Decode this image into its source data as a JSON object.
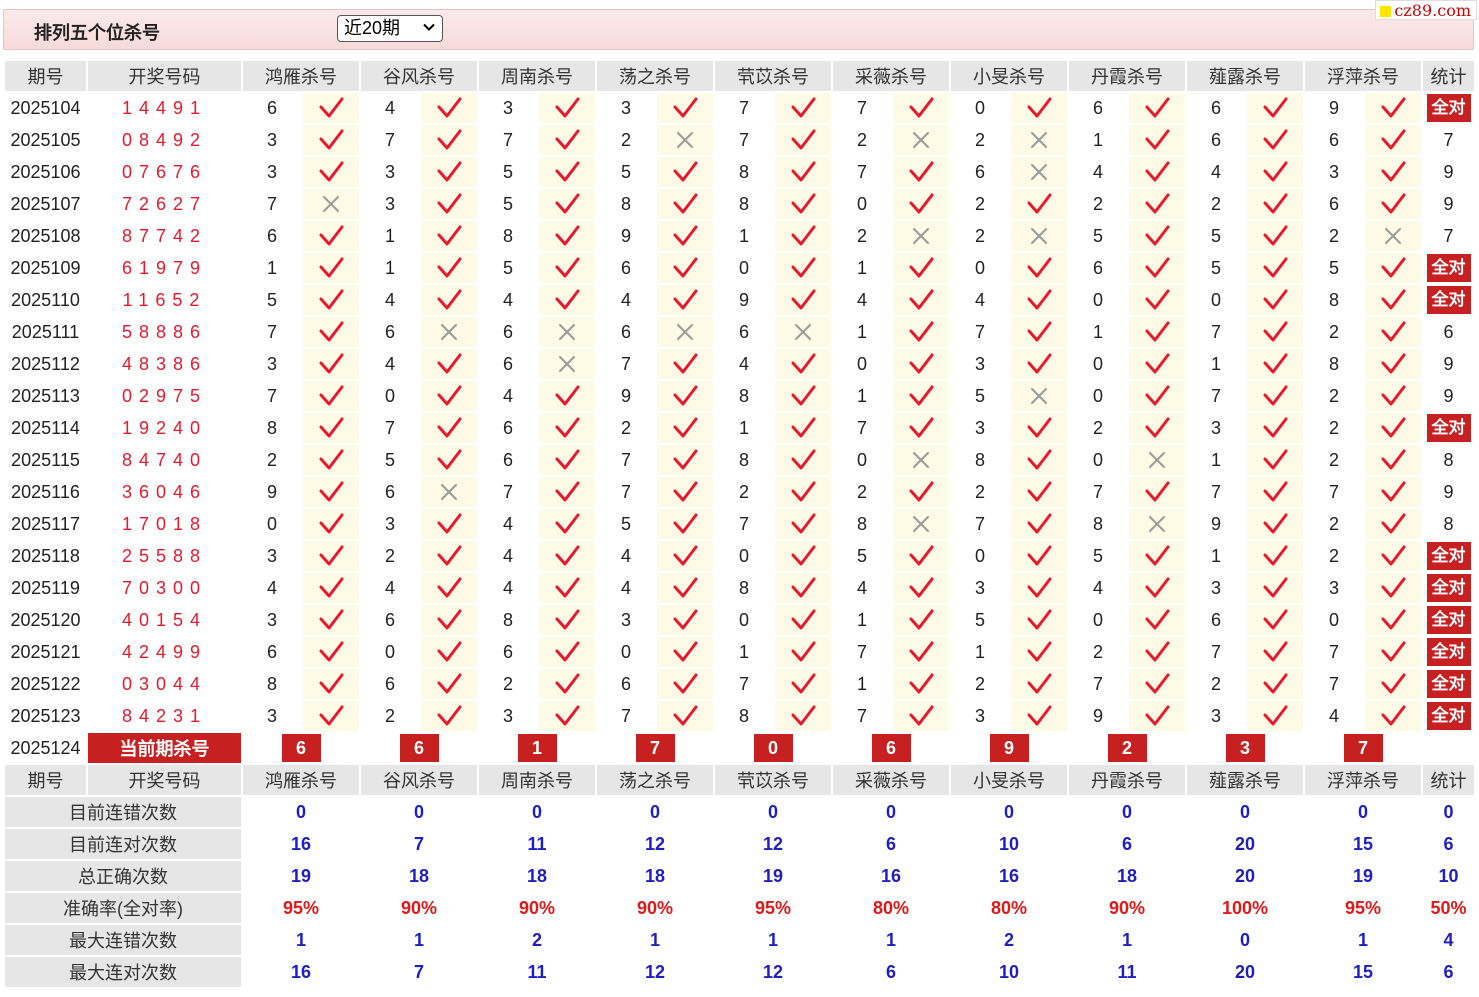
{
  "header": {
    "title": "排列五个位杀号",
    "select_value": "近20期"
  },
  "brand": "cz89.com",
  "columns": {
    "period": "期号",
    "number": "开奖号码",
    "experts": [
      "鸿雁杀号",
      "谷风杀号",
      "周南杀号",
      "荡之杀号",
      "茕苡杀号",
      "采薇杀号",
      "小旻杀号",
      "丹霞杀号",
      "薤露杀号",
      "浮萍杀号"
    ],
    "stat": "统计"
  },
  "rows": [
    {
      "period": "2025104",
      "number": "14491",
      "kills": [
        "6",
        "4",
        "3",
        "3",
        "7",
        "7",
        "0",
        "6",
        "6",
        "9"
      ],
      "marks": [
        1,
        1,
        1,
        1,
        1,
        1,
        1,
        1,
        1,
        1
      ],
      "stat": "全对"
    },
    {
      "period": "2025105",
      "number": "08492",
      "kills": [
        "3",
        "7",
        "7",
        "2",
        "7",
        "2",
        "2",
        "1",
        "6",
        "6"
      ],
      "marks": [
        1,
        1,
        1,
        0,
        1,
        0,
        0,
        1,
        1,
        1
      ],
      "stat": "7"
    },
    {
      "period": "2025106",
      "number": "07676",
      "kills": [
        "3",
        "3",
        "5",
        "5",
        "8",
        "7",
        "6",
        "4",
        "4",
        "3"
      ],
      "marks": [
        1,
        1,
        1,
        1,
        1,
        1,
        0,
        1,
        1,
        1
      ],
      "stat": "9"
    },
    {
      "period": "2025107",
      "number": "72627",
      "kills": [
        "7",
        "3",
        "5",
        "8",
        "8",
        "0",
        "2",
        "2",
        "2",
        "6"
      ],
      "marks": [
        0,
        1,
        1,
        1,
        1,
        1,
        1,
        1,
        1,
        1
      ],
      "stat": "9"
    },
    {
      "period": "2025108",
      "number": "87742",
      "kills": [
        "6",
        "1",
        "8",
        "9",
        "1",
        "2",
        "2",
        "5",
        "5",
        "2"
      ],
      "marks": [
        1,
        1,
        1,
        1,
        1,
        0,
        0,
        1,
        1,
        0
      ],
      "stat": "7"
    },
    {
      "period": "2025109",
      "number": "61979",
      "kills": [
        "1",
        "1",
        "5",
        "6",
        "0",
        "1",
        "0",
        "6",
        "5",
        "5"
      ],
      "marks": [
        1,
        1,
        1,
        1,
        1,
        1,
        1,
        1,
        1,
        1
      ],
      "stat": "全对"
    },
    {
      "period": "2025110",
      "number": "11652",
      "kills": [
        "5",
        "4",
        "4",
        "4",
        "9",
        "4",
        "4",
        "0",
        "0",
        "8"
      ],
      "marks": [
        1,
        1,
        1,
        1,
        1,
        1,
        1,
        1,
        1,
        1
      ],
      "stat": "全对"
    },
    {
      "period": "2025111",
      "number": "58886",
      "kills": [
        "7",
        "6",
        "6",
        "6",
        "6",
        "1",
        "7",
        "1",
        "7",
        "2"
      ],
      "marks": [
        1,
        0,
        0,
        0,
        0,
        1,
        1,
        1,
        1,
        1
      ],
      "stat": "6"
    },
    {
      "period": "2025112",
      "number": "48386",
      "kills": [
        "3",
        "4",
        "6",
        "7",
        "4",
        "0",
        "3",
        "0",
        "1",
        "8"
      ],
      "marks": [
        1,
        1,
        0,
        1,
        1,
        1,
        1,
        1,
        1,
        1
      ],
      "stat": "9"
    },
    {
      "period": "2025113",
      "number": "02975",
      "kills": [
        "7",
        "0",
        "4",
        "9",
        "8",
        "1",
        "5",
        "0",
        "7",
        "2"
      ],
      "marks": [
        1,
        1,
        1,
        1,
        1,
        1,
        0,
        1,
        1,
        1
      ],
      "stat": "9"
    },
    {
      "period": "2025114",
      "number": "19240",
      "kills": [
        "8",
        "7",
        "6",
        "2",
        "1",
        "7",
        "3",
        "2",
        "3",
        "2"
      ],
      "marks": [
        1,
        1,
        1,
        1,
        1,
        1,
        1,
        1,
        1,
        1
      ],
      "stat": "全对"
    },
    {
      "period": "2025115",
      "number": "84740",
      "kills": [
        "2",
        "5",
        "6",
        "7",
        "8",
        "0",
        "8",
        "0",
        "1",
        "2"
      ],
      "marks": [
        1,
        1,
        1,
        1,
        1,
        0,
        1,
        0,
        1,
        1
      ],
      "stat": "8"
    },
    {
      "period": "2025116",
      "number": "36046",
      "kills": [
        "9",
        "6",
        "7",
        "7",
        "2",
        "2",
        "2",
        "7",
        "7",
        "7"
      ],
      "marks": [
        1,
        0,
        1,
        1,
        1,
        1,
        1,
        1,
        1,
        1
      ],
      "stat": "9"
    },
    {
      "period": "2025117",
      "number": "17018",
      "kills": [
        "0",
        "3",
        "4",
        "5",
        "7",
        "8",
        "7",
        "8",
        "9",
        "2"
      ],
      "marks": [
        1,
        1,
        1,
        1,
        1,
        0,
        1,
        0,
        1,
        1
      ],
      "stat": "8"
    },
    {
      "period": "2025118",
      "number": "25588",
      "kills": [
        "3",
        "2",
        "4",
        "4",
        "0",
        "5",
        "0",
        "5",
        "1",
        "2"
      ],
      "marks": [
        1,
        1,
        1,
        1,
        1,
        1,
        1,
        1,
        1,
        1
      ],
      "stat": "全对"
    },
    {
      "period": "2025119",
      "number": "70300",
      "kills": [
        "4",
        "4",
        "4",
        "4",
        "8",
        "4",
        "3",
        "4",
        "3",
        "3"
      ],
      "marks": [
        1,
        1,
        1,
        1,
        1,
        1,
        1,
        1,
        1,
        1
      ],
      "stat": "全对"
    },
    {
      "period": "2025120",
      "number": "40154",
      "kills": [
        "3",
        "6",
        "8",
        "3",
        "0",
        "1",
        "5",
        "0",
        "6",
        "0"
      ],
      "marks": [
        1,
        1,
        1,
        1,
        1,
        1,
        1,
        1,
        1,
        1
      ],
      "stat": "全对"
    },
    {
      "period": "2025121",
      "number": "42499",
      "kills": [
        "6",
        "0",
        "6",
        "0",
        "1",
        "7",
        "1",
        "2",
        "7",
        "7"
      ],
      "marks": [
        1,
        1,
        1,
        1,
        1,
        1,
        1,
        1,
        1,
        1
      ],
      "stat": "全对"
    },
    {
      "period": "2025122",
      "number": "03044",
      "kills": [
        "8",
        "6",
        "2",
        "6",
        "7",
        "1",
        "2",
        "7",
        "2",
        "7"
      ],
      "marks": [
        1,
        1,
        1,
        1,
        1,
        1,
        1,
        1,
        1,
        1
      ],
      "stat": "全对"
    },
    {
      "period": "2025123",
      "number": "84231",
      "kills": [
        "3",
        "2",
        "3",
        "7",
        "8",
        "7",
        "3",
        "9",
        "3",
        "4"
      ],
      "marks": [
        1,
        1,
        1,
        1,
        1,
        1,
        1,
        1,
        1,
        1
      ],
      "stat": "全对"
    }
  ],
  "current": {
    "period": "2025124",
    "label": "当前期杀号",
    "kills": [
      "6",
      "6",
      "1",
      "7",
      "0",
      "6",
      "9",
      "2",
      "3",
      "7"
    ]
  },
  "summary": [
    {
      "label": "目前连错次数",
      "values": [
        "0",
        "0",
        "0",
        "0",
        "0",
        "0",
        "0",
        "0",
        "0",
        "0"
      ],
      "stat": "0",
      "color": "blue"
    },
    {
      "label": "目前连对次数",
      "values": [
        "16",
        "7",
        "11",
        "12",
        "12",
        "6",
        "10",
        "6",
        "20",
        "15"
      ],
      "stat": "6",
      "color": "blue"
    },
    {
      "label": "总正确次数",
      "values": [
        "19",
        "18",
        "18",
        "18",
        "19",
        "16",
        "16",
        "18",
        "20",
        "19"
      ],
      "stat": "10",
      "color": "blue"
    },
    {
      "label": "准确率(全对率)",
      "values": [
        "95%",
        "90%",
        "90%",
        "90%",
        "95%",
        "80%",
        "80%",
        "90%",
        "100%",
        "95%"
      ],
      "stat": "50%",
      "color": "red"
    },
    {
      "label": "最大连错次数",
      "values": [
        "1",
        "1",
        "2",
        "1",
        "1",
        "1",
        "2",
        "1",
        "0",
        "1"
      ],
      "stat": "4",
      "color": "blue"
    },
    {
      "label": "最大连对次数",
      "values": [
        "16",
        "7",
        "11",
        "12",
        "12",
        "6",
        "10",
        "11",
        "20",
        "15"
      ],
      "stat": "6",
      "color": "blue"
    }
  ],
  "colors": {
    "accent_red": "#c62020",
    "number_red": "#e8192c",
    "summary_blue": "#1f1fbf",
    "mark_bg": "#fdfbe6",
    "header_bg": "#e6e6e6"
  },
  "icons": {
    "hit": "check-icon",
    "miss": "cross-icon",
    "dropdown": "chevron-down-icon"
  }
}
